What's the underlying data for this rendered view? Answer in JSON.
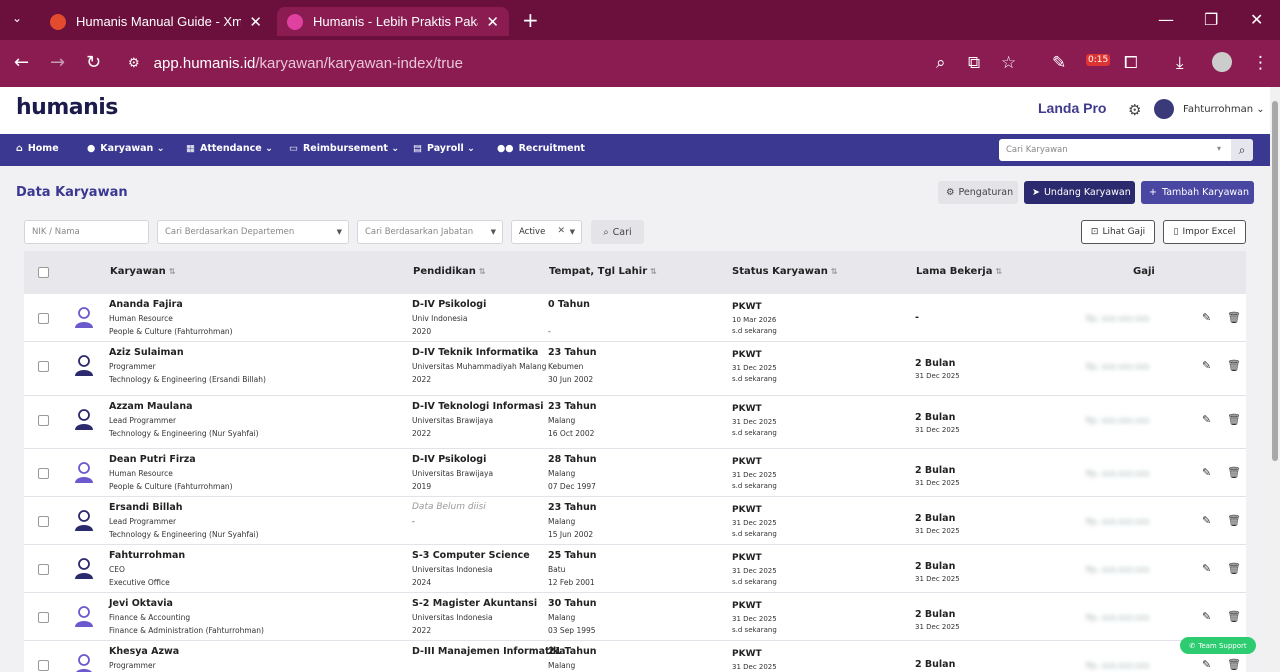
{
  "browser": {
    "tabs": [
      {
        "title": "Humanis Manual Guide - Xmind",
        "fav_color": "#e24b2e",
        "active": false
      },
      {
        "title": "Humanis - Lebih Praktis Pakai Humanis",
        "fav_color": "#e040a0",
        "active": true
      }
    ],
    "new_tab": "+",
    "url_host": "app.humanis.id",
    "url_path": "/karyawan/karyawan-index/true",
    "timer_badge": "0:15"
  },
  "app": {
    "logo": "humanis",
    "company": "Landa Pro",
    "user": "Fahturrohman",
    "menu": [
      {
        "label": "Home",
        "icon": "⌂"
      },
      {
        "label": "Karyawan",
        "icon": "👤",
        "dropdown": true
      },
      {
        "label": "Attendance",
        "icon": "📅",
        "dropdown": true
      },
      {
        "label": "Reimbursement",
        "icon": "💵",
        "dropdown": true
      },
      {
        "label": "Payroll",
        "icon": "📁",
        "dropdown": true
      },
      {
        "label": "Recruitment",
        "icon": "👥"
      }
    ],
    "search_employee_placeholder": "Cari Karyawan"
  },
  "page": {
    "title": "Data Karyawan",
    "btn_settings": "Pengaturan",
    "btn_invite": "Undang Karyawan",
    "btn_add": "Tambah Karyawan",
    "filters": {
      "nik": "NIK / Nama",
      "departemen": "Cari Berdasarkan Departemen",
      "jabatan": "Cari Berdasarkan Jabatan",
      "status": "Active",
      "cari": "Cari"
    },
    "btn_lihat_gaji": "Lihat Gaji",
    "btn_impor": "Impor Excel",
    "columns": [
      "Karyawan",
      "Pendidikan",
      "Tempat, Tgl Lahir",
      "Status Karyawan",
      "Lama Bekerja",
      "Gaji"
    ],
    "rows": [
      {
        "name": "Ananda Fajira",
        "role": "Human Resource",
        "dept": "People & Culture (Fahturrohman)",
        "edu": "D-IV Psikologi",
        "school": "Univ Indonesia",
        "year": "2020",
        "age": "0 Tahun",
        "place": "",
        "dob": "-",
        "status": "PKWT",
        "status_date": "10 Mar 2026",
        "status_until": "s.d sekarang",
        "lama": "-",
        "lama_date": "",
        "gender": "f"
      },
      {
        "name": "Aziz Sulaiman",
        "role": "Programmer",
        "dept": "Technology & Engineering (Ersandi Billah)",
        "edu": "D-IV Teknik Informatika",
        "school": "Universitas Muhammadiyah Malang",
        "year": "2022",
        "age": "23 Tahun",
        "place": "Kebumen",
        "dob": "30 Jun 2002",
        "status": "PKWT",
        "status_date": "31 Dec 2025",
        "status_until": "s.d sekarang",
        "lama": "2 Bulan",
        "lama_date": "31 Dec 2025",
        "gender": "m"
      },
      {
        "name": "Azzam Maulana",
        "role": "Lead Programmer",
        "dept": "Technology & Engineering (Nur Syahfai)",
        "edu": "D-IV Teknologi Informasi",
        "school": "Universitas Brawijaya",
        "year": "2022",
        "age": "23 Tahun",
        "place": "Malang",
        "dob": "16 Oct 2002",
        "status": "PKWT",
        "status_date": "31 Dec 2025",
        "status_until": "s.d sekarang",
        "lama": "2 Bulan",
        "lama_date": "31 Dec 2025",
        "gender": "m"
      },
      {
        "name": "Dean Putri Firza",
        "role": "Human Resource",
        "dept": "People & Culture (Fahturrohman)",
        "edu": "D-IV Psikologi",
        "school": "Universitas Brawijaya",
        "year": "2019",
        "age": "28 Tahun",
        "place": "Malang",
        "dob": "07 Dec 1997",
        "status": "PKWT",
        "status_date": "31 Dec 2025",
        "status_until": "s.d sekarang",
        "lama": "2 Bulan",
        "lama_date": "31 Dec 2025",
        "gender": "f"
      },
      {
        "name": "Ersandi Billah",
        "role": "Lead Programmer",
        "dept": "Technology & Engineering (Nur Syahfai)",
        "edu": "Data Belum diisi",
        "school": "-",
        "year": "",
        "age": "23 Tahun",
        "place": "Malang",
        "dob": "15 Jun 2002",
        "status": "PKWT",
        "status_date": "31 Dec 2025",
        "status_until": "s.d sekarang",
        "lama": "2 Bulan",
        "lama_date": "31 Dec 2025",
        "gender": "m",
        "edu_empty": true
      },
      {
        "name": "Fahturrohman",
        "role": "CEO",
        "dept": "Executive Office",
        "edu": "S-3 Computer Science",
        "school": "Universitas Indonesia",
        "year": "2024",
        "age": "25 Tahun",
        "place": "Batu",
        "dob": "12 Feb 2001",
        "status": "PKWT",
        "status_date": "31 Dec 2025",
        "status_until": "s.d sekarang",
        "lama": "2 Bulan",
        "lama_date": "31 Dec 2025",
        "gender": "m"
      },
      {
        "name": "Jevi Oktavia",
        "role": "Finance & Accounting",
        "dept": "Finance & Administration (Fahturrohman)",
        "edu": "S-2 Magister Akuntansi",
        "school": "Universitas Indonesia",
        "year": "2022",
        "age": "30 Tahun",
        "place": "Malang",
        "dob": "03 Sep 1995",
        "status": "PKWT",
        "status_date": "31 Dec 2025",
        "status_until": "s.d sekarang",
        "lama": "2 Bulan",
        "lama_date": "31 Dec 2025",
        "gender": "f"
      },
      {
        "name": "Khesya Azwa",
        "role": "Programmer",
        "dept": "",
        "edu": "D-III Manajemen Informatika",
        "school": "",
        "year": "",
        "age": "21 Tahun",
        "place": "Malang",
        "dob": "",
        "status": "PKWT",
        "status_date": "31 Dec 2025",
        "status_until": "",
        "lama": "2 Bulan",
        "lama_date": "",
        "gender": "f"
      }
    ],
    "gaji_mask": "Rp. xxx.xxx.xxx",
    "team_support": "Team Support"
  },
  "colors": {
    "primary": "#3b3891",
    "browser": "#8a1c52"
  }
}
